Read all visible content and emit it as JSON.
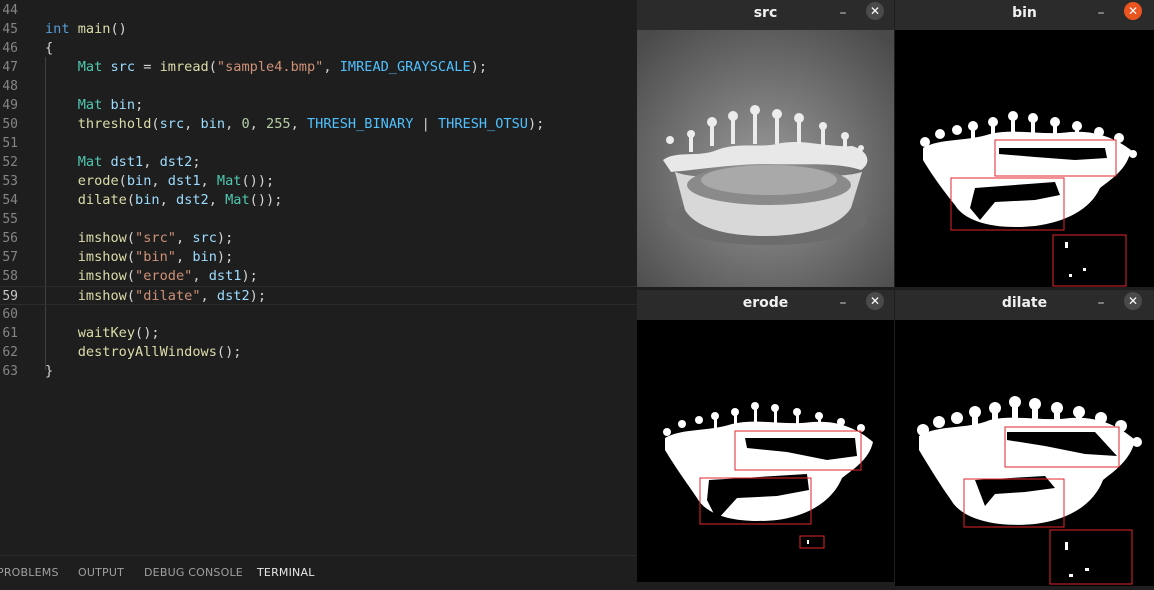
{
  "editor": {
    "lines": [
      {
        "n": "44",
        "tokens": []
      },
      {
        "n": "45",
        "tokens": [
          [
            "kw",
            "int"
          ],
          [
            "pl",
            " "
          ],
          [
            "fn",
            "main"
          ],
          [
            "pl",
            "()"
          ]
        ]
      },
      {
        "n": "46",
        "tokens": [
          [
            "pl",
            "{"
          ]
        ]
      },
      {
        "n": "47",
        "tokens": [
          [
            "pl",
            "    "
          ],
          [
            "ty",
            "Mat"
          ],
          [
            "pl",
            " "
          ],
          [
            "var",
            "src"
          ],
          [
            "pl",
            " = "
          ],
          [
            "fn",
            "imread"
          ],
          [
            "pl",
            "("
          ],
          [
            "st",
            "\"sample4.bmp\""
          ],
          [
            "pl",
            ", "
          ],
          [
            "cst",
            "IMREAD_GRAYSCALE"
          ],
          [
            "pl",
            ");"
          ]
        ]
      },
      {
        "n": "48",
        "tokens": []
      },
      {
        "n": "49",
        "tokens": [
          [
            "pl",
            "    "
          ],
          [
            "ty",
            "Mat"
          ],
          [
            "pl",
            " "
          ],
          [
            "var",
            "bin"
          ],
          [
            "pl",
            ";"
          ]
        ]
      },
      {
        "n": "50",
        "tokens": [
          [
            "pl",
            "    "
          ],
          [
            "fn",
            "threshold"
          ],
          [
            "pl",
            "("
          ],
          [
            "var",
            "src"
          ],
          [
            "pl",
            ", "
          ],
          [
            "var",
            "bin"
          ],
          [
            "pl",
            ", "
          ],
          [
            "num",
            "0"
          ],
          [
            "pl",
            ", "
          ],
          [
            "num",
            "255"
          ],
          [
            "pl",
            ", "
          ],
          [
            "cst",
            "THRESH_BINARY"
          ],
          [
            "pl",
            " | "
          ],
          [
            "cst",
            "THRESH_OTSU"
          ],
          [
            "pl",
            ");"
          ]
        ]
      },
      {
        "n": "51",
        "tokens": []
      },
      {
        "n": "52",
        "tokens": [
          [
            "pl",
            "    "
          ],
          [
            "ty",
            "Mat"
          ],
          [
            "pl",
            " "
          ],
          [
            "var",
            "dst1"
          ],
          [
            "pl",
            ", "
          ],
          [
            "var",
            "dst2"
          ],
          [
            "pl",
            ";"
          ]
        ]
      },
      {
        "n": "53",
        "tokens": [
          [
            "pl",
            "    "
          ],
          [
            "fn",
            "erode"
          ],
          [
            "pl",
            "("
          ],
          [
            "var",
            "bin"
          ],
          [
            "pl",
            ", "
          ],
          [
            "var",
            "dst1"
          ],
          [
            "pl",
            ", "
          ],
          [
            "ty",
            "Mat"
          ],
          [
            "pl",
            "());"
          ]
        ]
      },
      {
        "n": "54",
        "tokens": [
          [
            "pl",
            "    "
          ],
          [
            "fn",
            "dilate"
          ],
          [
            "pl",
            "("
          ],
          [
            "var",
            "bin"
          ],
          [
            "pl",
            ", "
          ],
          [
            "var",
            "dst2"
          ],
          [
            "pl",
            ", "
          ],
          [
            "ty",
            "Mat"
          ],
          [
            "pl",
            "());"
          ]
        ]
      },
      {
        "n": "55",
        "tokens": []
      },
      {
        "n": "56",
        "tokens": [
          [
            "pl",
            "    "
          ],
          [
            "fn",
            "imshow"
          ],
          [
            "pl",
            "("
          ],
          [
            "st",
            "\"src\""
          ],
          [
            "pl",
            ", "
          ],
          [
            "var",
            "src"
          ],
          [
            "pl",
            ");"
          ]
        ]
      },
      {
        "n": "57",
        "tokens": [
          [
            "pl",
            "    "
          ],
          [
            "fn",
            "imshow"
          ],
          [
            "pl",
            "("
          ],
          [
            "st",
            "\"bin\""
          ],
          [
            "pl",
            ", "
          ],
          [
            "var",
            "bin"
          ],
          [
            "pl",
            ");"
          ]
        ]
      },
      {
        "n": "58",
        "tokens": [
          [
            "pl",
            "    "
          ],
          [
            "fn",
            "imshow"
          ],
          [
            "pl",
            "("
          ],
          [
            "st",
            "\"erode\""
          ],
          [
            "pl",
            ", "
          ],
          [
            "var",
            "dst1"
          ],
          [
            "pl",
            ");"
          ]
        ]
      },
      {
        "n": "59",
        "active": true,
        "tokens": [
          [
            "pl",
            "    "
          ],
          [
            "fn",
            "imshow"
          ],
          [
            "pl",
            "("
          ],
          [
            "st",
            "\"dilate\""
          ],
          [
            "pl",
            ", "
          ],
          [
            "var",
            "dst2"
          ],
          [
            "pl",
            ");"
          ]
        ]
      },
      {
        "n": "60",
        "tokens": []
      },
      {
        "n": "61",
        "tokens": [
          [
            "pl",
            "    "
          ],
          [
            "fn",
            "waitKey"
          ],
          [
            "pl",
            "();"
          ]
        ]
      },
      {
        "n": "62",
        "tokens": [
          [
            "pl",
            "    "
          ],
          [
            "fn",
            "destroyAllWindows"
          ],
          [
            "pl",
            "();"
          ]
        ]
      },
      {
        "n": "63",
        "tokens": [
          [
            "pl",
            "}"
          ]
        ]
      }
    ]
  },
  "panel": {
    "tabs": [
      {
        "label": "PROBLEMS",
        "active": false
      },
      {
        "label": "OUTPUT",
        "active": false
      },
      {
        "label": "DEBUG CONSOLE",
        "active": false
      },
      {
        "label": "TERMINAL",
        "active": true
      }
    ]
  },
  "windows": {
    "src": {
      "title": "src",
      "min_icon": "minimize-icon",
      "close_icon": "close-icon",
      "min": "–",
      "close": "✕"
    },
    "bin": {
      "title": "bin",
      "min_icon": "minimize-icon",
      "close_icon": "close-icon",
      "min": "–",
      "close": "✕"
    },
    "erode": {
      "title": "erode",
      "min_icon": "minimize-icon",
      "close_icon": "close-icon",
      "min": "–",
      "close": "✕"
    },
    "dilate": {
      "title": "dilate",
      "min_icon": "minimize-icon",
      "close_icon": "close-icon",
      "min": "–",
      "close": "✕"
    }
  },
  "colors": {
    "close_active": "#e9541f",
    "highlight_box": "#e0262b"
  }
}
